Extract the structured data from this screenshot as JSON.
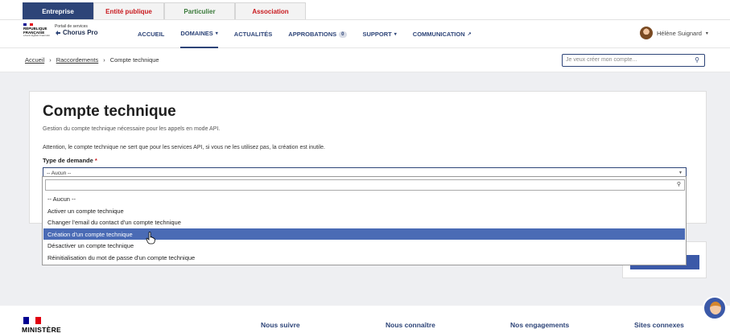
{
  "tabs": [
    "Entreprise",
    "Entité publique",
    "Particulier",
    "Association"
  ],
  "logo": {
    "republic": "RÉPUBLIQUE FRANÇAISE",
    "motto": "Liberté Égalité Fraternité",
    "brand_small": "Portail de services",
    "brand_big": "Chorus Pro"
  },
  "nav": {
    "items": [
      {
        "label": "ACCUEIL"
      },
      {
        "label": "DOMAINES",
        "chevron": "▾"
      },
      {
        "label": "ACTUALITÉS"
      },
      {
        "label": "APPROBATIONS",
        "badge": "0"
      },
      {
        "label": "SUPPORT",
        "chevron": "▾"
      },
      {
        "label": "COMMUNICATION",
        "icon": "↗"
      }
    ]
  },
  "user": {
    "name": "Hélène Suignard",
    "chevron": "▾"
  },
  "breadcrumb": {
    "items": [
      "Accueil",
      "Raccordements",
      "Compte technique"
    ],
    "separator": "›"
  },
  "search": {
    "placeholder": "Je veux créer mon compte..."
  },
  "page": {
    "title": "Compte technique",
    "subtitle": "Gestion du compte technique nécessaire pour les appels en mode API.",
    "warning": "Attention, le compte technique ne sert que pour les services API, si vous ne les utilisez pas, la création est inutile.",
    "field_label": "Type de demande",
    "required_mark": "*",
    "select_value": "-- Aucun --"
  },
  "dropdown": {
    "options": [
      "-- Aucun --",
      "Activer un compte technique",
      "Changer l'email du contact d'un compte technique",
      "Création d'un compte technique",
      "Désactiver un compte technique",
      "Réinitialisation du mot de passe d'un compte technique"
    ],
    "highlighted_index": 3
  },
  "footer": {
    "ministry": "MINISTÈRE",
    "links": [
      "Nous suivre",
      "Nous connaître",
      "Nos engagements",
      "Sites connexes"
    ]
  },
  "colors": {
    "primary": "#2d4478",
    "highlight": "#4a6bb5",
    "accent_red": "#c9191e",
    "background": "#eeeff2"
  }
}
